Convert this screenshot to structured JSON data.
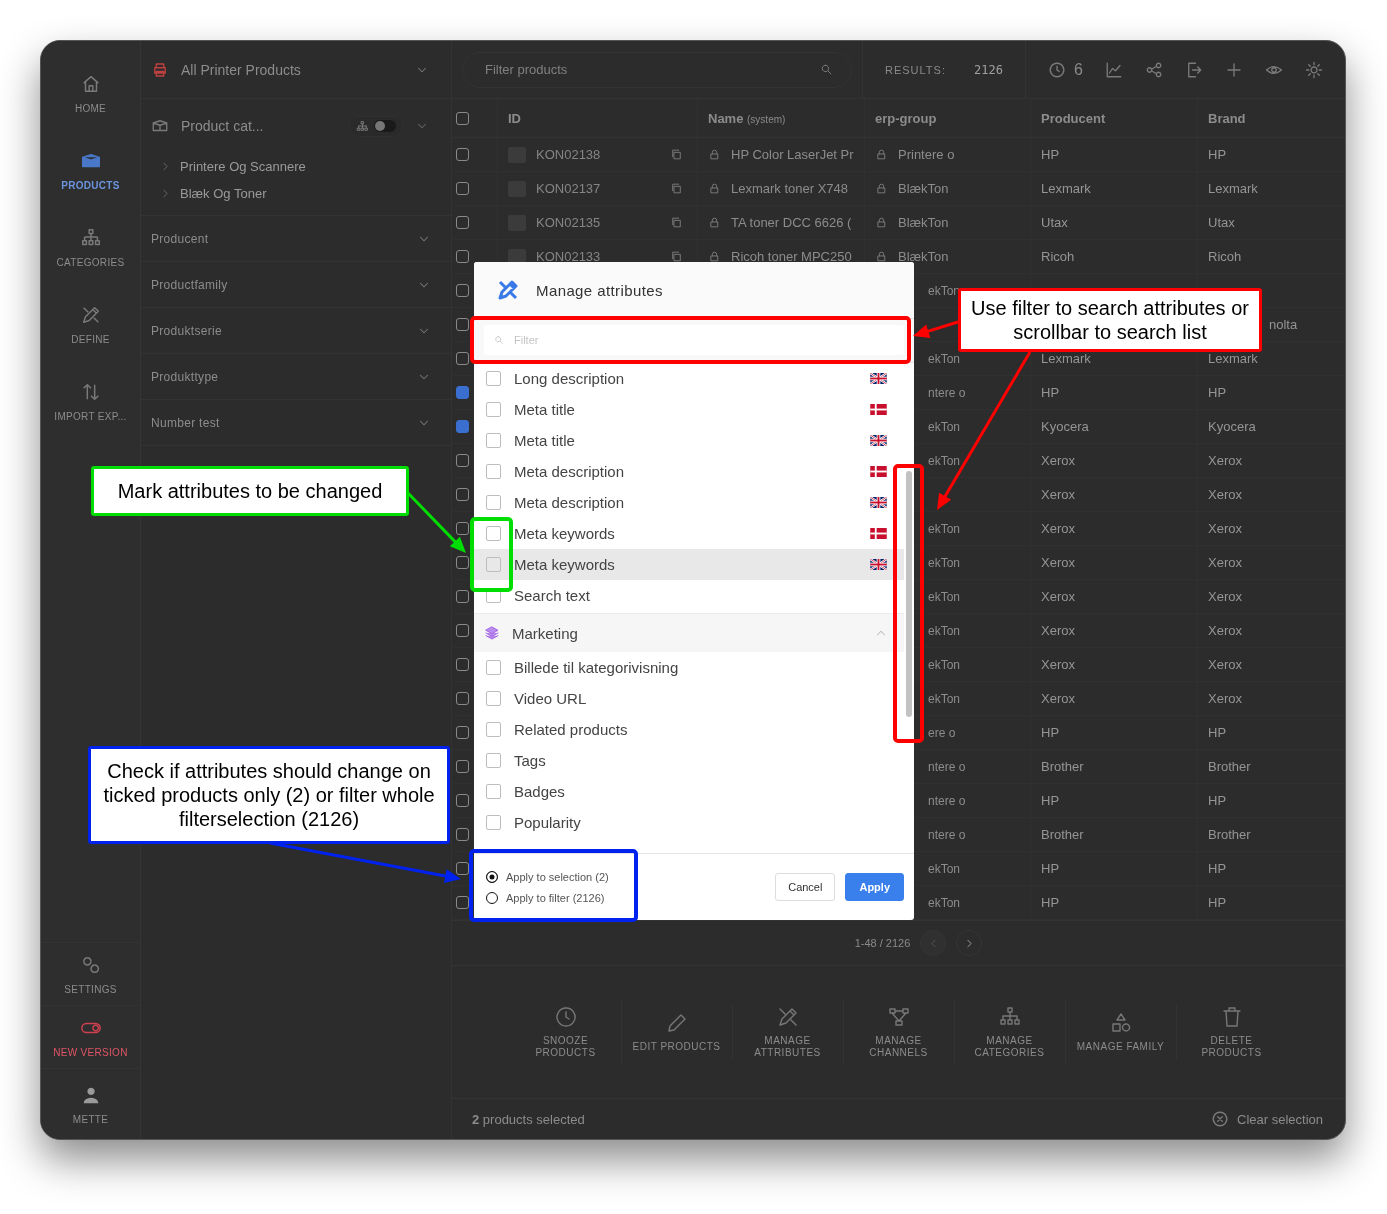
{
  "sidebar": {
    "items": [
      {
        "label": "HOME",
        "selected": false
      },
      {
        "label": "PRODUCTS",
        "selected": true
      },
      {
        "label": "CATEGORIES",
        "selected": false
      },
      {
        "label": "DEFINE",
        "selected": false
      },
      {
        "label": "IMPORT EXP...",
        "selected": false
      }
    ],
    "bottom_items": [
      {
        "label": "SETTINGS",
        "kind": "settings"
      },
      {
        "label": "NEW VERSION",
        "kind": "version"
      },
      {
        "label": "METTE",
        "kind": "user"
      }
    ]
  },
  "filter_panel": {
    "collection": "All Printer Products",
    "category": {
      "label": "Product cat...",
      "tree_view_on": false,
      "children": [
        {
          "label": "Printere Og Scannere",
          "expanded": false
        },
        {
          "label": "Blæk Og Toner",
          "expanded": false
        }
      ]
    },
    "sections": [
      {
        "label": "Producent",
        "expanded": false
      },
      {
        "label": "Productfamily",
        "expanded": false
      },
      {
        "label": "Produktserie",
        "expanded": false
      },
      {
        "label": "Produkttype",
        "expanded": false
      },
      {
        "label": "Number test",
        "expanded": false
      }
    ]
  },
  "toolbar": {
    "search_placeholder": "Filter products",
    "results_label": "RESULTS:",
    "results": "2126",
    "snoozed": "6"
  },
  "table": {
    "select_all_checked": false,
    "columns": [
      {
        "label": "ID"
      },
      {
        "label": "Name",
        "note": "(system)"
      },
      {
        "label": "erp-group"
      },
      {
        "label": "Producent"
      },
      {
        "label": "Brand"
      }
    ],
    "rows": [
      {
        "checked": false,
        "id": "KON02138",
        "name": "HP Color LaserJet Pr",
        "erp_group": "Printere o",
        "producent": "HP",
        "brand": "HP"
      },
      {
        "checked": false,
        "id": "KON02137",
        "name": "Lexmark toner X748",
        "erp_group": "BlækTon",
        "producent": "Lexmark",
        "brand": "Lexmark"
      },
      {
        "checked": false,
        "id": "KON02135",
        "name": "TA toner DCC 6626 (",
        "erp_group": "BlækTon",
        "producent": "Utax",
        "brand": "Utax"
      },
      {
        "checked": false,
        "id": "KON02133",
        "name": "Ricoh toner MPC250",
        "erp_group": "BlækTon",
        "producent": "Ricoh",
        "brand": "Ricoh"
      },
      {
        "checked": false,
        "erp_group": "ekTon"
      },
      {
        "checked": false,
        "brand": "nolta"
      },
      {
        "checked": false,
        "erp_group": "ekTon",
        "producent": "Lexmark",
        "brand": "Lexmark"
      },
      {
        "checked": true,
        "erp_group": "ntere o",
        "producent": "HP",
        "brand": "HP"
      },
      {
        "checked": true,
        "erp_group": "ekTon",
        "producent": "Kyocera",
        "brand": "Kyocera"
      },
      {
        "checked": false,
        "erp_group": "ekTon",
        "producent": "Xerox",
        "brand": "Xerox"
      },
      {
        "checked": false,
        "producent": "Xerox",
        "brand": "Xerox"
      },
      {
        "checked": false,
        "erp_group": "ekTon",
        "producent": "Xerox",
        "brand": "Xerox"
      },
      {
        "checked": false,
        "erp_group": "ekTon",
        "producent": "Xerox",
        "brand": "Xerox"
      },
      {
        "checked": false,
        "erp_group": "ekTon",
        "producent": "Xerox",
        "brand": "Xerox"
      },
      {
        "checked": false,
        "erp_group": "ekTon",
        "producent": "Xerox",
        "brand": "Xerox"
      },
      {
        "checked": false,
        "erp_group": "ekTon",
        "producent": "Xerox",
        "brand": "Xerox"
      },
      {
        "checked": false,
        "erp_group": "ekTon",
        "producent": "Xerox",
        "brand": "Xerox"
      },
      {
        "checked": false,
        "erp_group": "ere o",
        "producent": "HP",
        "brand": "HP"
      },
      {
        "checked": false,
        "erp_group": "ntere o",
        "producent": "Brother",
        "brand": "Brother"
      },
      {
        "checked": false,
        "erp_group": "ntere o",
        "producent": "HP",
        "brand": "HP"
      },
      {
        "checked": false,
        "erp_group": "ntere o",
        "producent": "Brother",
        "brand": "Brother"
      },
      {
        "checked": false,
        "erp_group": "ekTon",
        "producent": "HP",
        "brand": "HP"
      },
      {
        "checked": false,
        "erp_group": "ekTon",
        "producent": "HP",
        "brand": "HP"
      }
    ]
  },
  "pagination": {
    "range": "1-48 / 2126"
  },
  "actions": [
    {
      "label": "SNOOZE PRODUCTS"
    },
    {
      "label": "EDIT PRODUCTS"
    },
    {
      "label": "MANAGE ATTRIBUTES"
    },
    {
      "label": "MANAGE CHANNELS"
    },
    {
      "label": "MANAGE CATEGORIES"
    },
    {
      "label": "MANAGE FAMILY"
    },
    {
      "label": "DELETE PRODUCTS"
    }
  ],
  "footer": {
    "selection": "**2** products selected",
    "clear": "Clear selection"
  },
  "modal": {
    "title": "Manage attributes",
    "filter_placeholder": "Filter",
    "items": [
      {
        "kind": "english",
        "label": "Long description",
        "checked": false,
        "hovered": false
      },
      {
        "kind": "danish",
        "label": "Meta title",
        "checked": false,
        "hovered": false
      },
      {
        "kind": "english",
        "label": "Meta title",
        "checked": false,
        "hovered": false
      },
      {
        "kind": "danish",
        "label": "Meta description",
        "checked": false,
        "hovered": false
      },
      {
        "kind": "english",
        "label": "Meta description",
        "checked": false,
        "hovered": false
      },
      {
        "kind": "danish",
        "label": "Meta keywords",
        "checked": false,
        "hovered": false
      },
      {
        "kind": "english",
        "label": "Meta keywords",
        "checked": false,
        "hovered": true
      },
      {
        "kind": "attribute",
        "label": "Search text",
        "checked": false,
        "hovered": false
      },
      {
        "kind": "group",
        "label": "Marketing",
        "expanded": true
      },
      {
        "kind": "attribute",
        "label": "Billede til kategorivisning",
        "checked": false,
        "hovered": false
      },
      {
        "kind": "attribute",
        "label": "Video URL",
        "checked": false,
        "hovered": false
      },
      {
        "kind": "attribute",
        "label": "Related products",
        "checked": false,
        "hovered": false
      },
      {
        "kind": "attribute",
        "label": "Tags",
        "checked": false,
        "hovered": false
      },
      {
        "kind": "attribute",
        "label": "Badges",
        "checked": false,
        "hovered": false
      },
      {
        "kind": "attribute",
        "label": "Popularity",
        "checked": false,
        "hovered": false
      }
    ],
    "scope": [
      {
        "label": "Apply to selection (2)",
        "selected": true
      },
      {
        "label": "Apply to filter (2126)",
        "selected": false
      }
    ],
    "buttons": [
      {
        "label": "Cancel",
        "kind": "secondary"
      },
      {
        "label": "Apply",
        "kind": "primary"
      }
    ]
  },
  "annotations": [
    {
      "text": "Use filter to search attributes or scrollbar to search list",
      "color": "#ff0000"
    },
    {
      "text": "Mark attributes to be changed",
      "color": "#00dd00"
    },
    {
      "text": "Check if attributes should change on ticked products only (2) or filter whole filterselection (2126)",
      "color": "#0022ee"
    }
  ]
}
